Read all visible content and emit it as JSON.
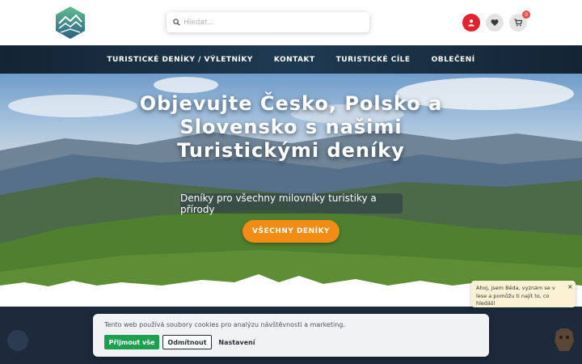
{
  "header": {
    "search": {
      "placeholder": "Hledat..."
    },
    "cart": {
      "badge_count": "0"
    }
  },
  "nav": {
    "items": [
      {
        "label": "TURISTICKÉ DENÍKY / VÝLETNÍKY"
      },
      {
        "label": "KONTAKT"
      },
      {
        "label": "TURISTICKÉ CÍLE"
      },
      {
        "label": "OBLEČENÍ"
      }
    ]
  },
  "hero": {
    "title": "Objevujte Česko, Polsko a Slovensko s našimi Turistickými deníky",
    "subtitle": "Deníky pro všechny milovníky turistiky a přírody",
    "cta_label": "VŠECHNY DENÍKY"
  },
  "cookie": {
    "text": "Tento web používá soubory cookies pro analýzu návštěvnosti a marketing.",
    "accept_label": "Přijmout vše",
    "decline_label": "Odmítnout",
    "settings_label": "Nastavení"
  },
  "chat": {
    "message": "Ahoj, jsem Běda, vyznám se v lese a pomůžu ti najít to, co hledáš!",
    "close_label": "×"
  },
  "colors": {
    "accent_orange": "#f28c15",
    "nav_dark": "#1c2f42",
    "user_red": "#e0232f",
    "accept_green": "#1e9e4f"
  }
}
